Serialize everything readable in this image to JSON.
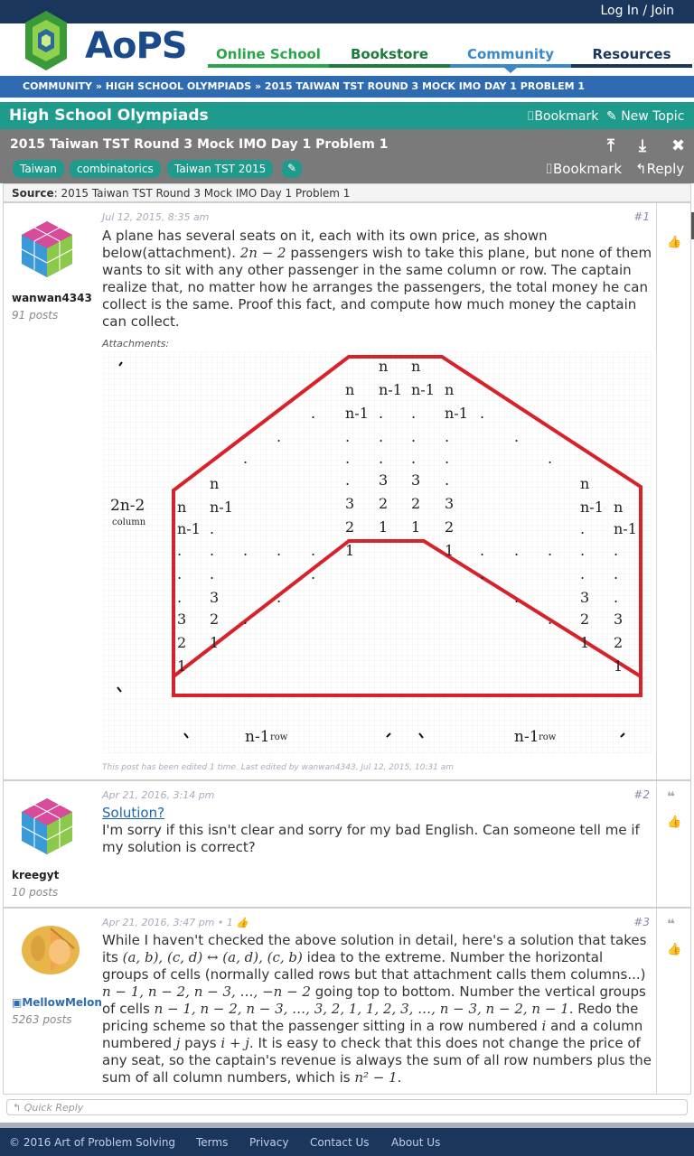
{
  "header": {
    "login_label": "Log In / Join",
    "logo_text": "AoPS",
    "nav": [
      "Online School",
      "Bookstore",
      "Community",
      "Resources"
    ],
    "breadcrumb": "COMMUNITY » HIGH SCHOOL OLYMPIADS » 2015 TAIWAN TST ROUND 3 MOCK IMO DAY 1 PROBLEM 1"
  },
  "section": {
    "title": "High School Olympiads",
    "bookmark": "Bookmark",
    "new_topic": "New Topic"
  },
  "topic": {
    "title": "2015 Taiwan TST Round 3 Mock IMO Day 1 Problem 1",
    "tags": [
      "Taiwan",
      "combinatorics",
      "Taiwan TST 2015"
    ],
    "bookmark": "Bookmark",
    "reply": "Reply",
    "source_label": "Source",
    "source_value": ": 2015 Taiwan TST Round 3 Mock IMO Day 1 Problem 1"
  },
  "posts": [
    {
      "username": "wanwan4343",
      "posts": "91 posts",
      "date": "Jul 12, 2015, 8:35 am",
      "number": "#1",
      "text_a": "A plane has several seats on it, each with its own price, as shown below(attachment). ",
      "math_a": "2n − 2",
      "text_b": " passengers wish to take this plane, but none of them wants to sit with any other passenger in the same column or row. The captain realize that, no matter how he arranges the passengers, the total money he can collect is the same. Proof this fact, and compute how much money the captain can collect.",
      "attachments_label": "Attachments:",
      "edited": "This post has been edited 1 time. Last edited by wanwan4343, Jul 12, 2015, 10:31 am",
      "diagram": {
        "left_label": "2n-2",
        "left_sub": "column",
        "bottom_label": "n-1",
        "bottom_sub": "row",
        "cells": [
          "n",
          "n-1",
          "3",
          "2",
          "1",
          "."
        ]
      }
    },
    {
      "username": "kreegyt",
      "posts": "10 posts",
      "date": "Apr 21, 2016, 3:14 pm",
      "number": "#2",
      "link": "Solution?",
      "text": "I'm sorry if this isn't clear and sorry for my bad English. Can someone tell me if my solution is correct?"
    },
    {
      "username": "MellowMelon",
      "posts": "5263 posts",
      "date": "Apr 21, 2016, 3:47 pm",
      "likes": "• 1",
      "number": "#3",
      "t1": "While I haven't checked the above solution in detail, here's a solution that takes its ",
      "m1": "(a, b), (c, d) ↔ (a, d), (c, b)",
      "t2": " idea to the extreme. Number the horizontal groups of cells (normally called rows but that attachment calls them columns...) ",
      "m2": "n − 1, n − 2, n − 3, …, −n − 2",
      "t3": " going top to bottom. Number the vertical groups of cells ",
      "m3": "n − 1, n − 2, n − 3, …, 3, 2, 1, 1, 2, 3, …, n − 3, n − 2, n − 1",
      "t4": ". Redo the pricing scheme so that the passenger sitting in a row numbered ",
      "m4": "i",
      "t5": " and a column numbered ",
      "m5": "j",
      "t6": " pays ",
      "m6": "i + j",
      "t7": ". It is easy to check that this does not change the price of any seat, so the captain's revenue is always the sum of all row numbers plus the sum of all column numbers, which is ",
      "m7": "n² − 1",
      "t8": "."
    }
  ],
  "quick_reply": "Quick Reply",
  "footer": [
    "© 2016 Art of Problem Solving",
    "Terms",
    "Privacy",
    "Contact Us",
    "About Us"
  ]
}
